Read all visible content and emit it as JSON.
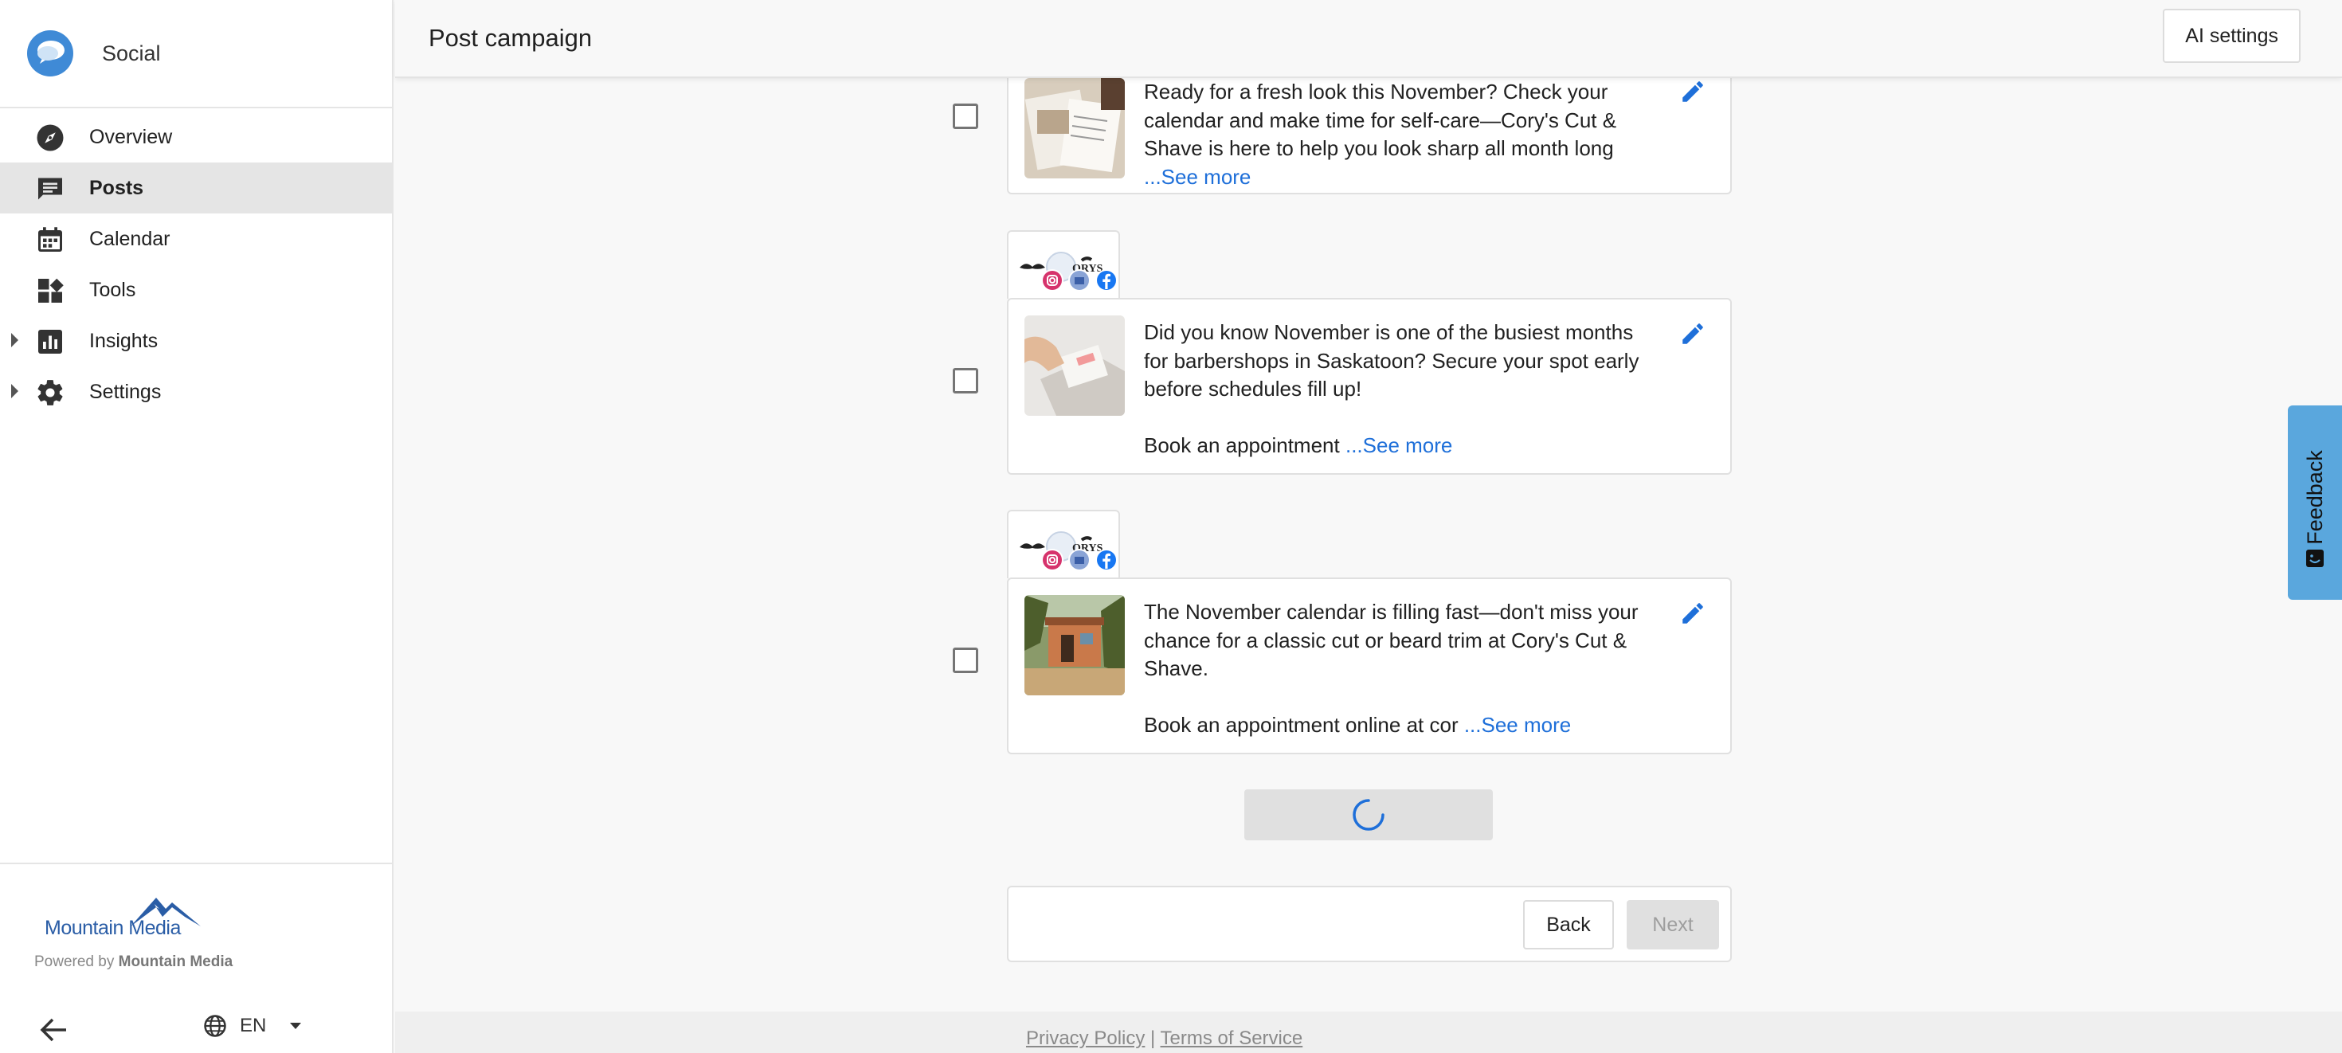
{
  "app": {
    "name": "Social"
  },
  "sidebar": {
    "items": [
      {
        "label": "Overview",
        "icon": "compass-icon"
      },
      {
        "label": "Posts",
        "icon": "chat-icon",
        "active": true
      },
      {
        "label": "Calendar",
        "icon": "calendar-icon"
      },
      {
        "label": "Tools",
        "icon": "tools-icon"
      },
      {
        "label": "Insights",
        "icon": "chart-icon",
        "expandable": true
      },
      {
        "label": "Settings",
        "icon": "gear-icon",
        "expandable": true
      }
    ],
    "brand_logo_text": "Mountain Media",
    "powered_prefix": "Powered by ",
    "powered_name": "Mountain Media",
    "language": "EN"
  },
  "header": {
    "title": "Post campaign",
    "ai_settings_label": "AI settings"
  },
  "posts": [
    {
      "lines": [
        "Ready for a fresh look this November? Check your",
        "calendar and make time for self-care—Cory's Cut &",
        "Shave is here to help you look sharp all month long"
      ],
      "extra": "",
      "see_more": "...See more",
      "image": "notebook-photo"
    },
    {
      "lines": [
        "Did you know November is one of the busiest months",
        "for barbershops in Saskatoon? Secure your spot early",
        "before schedules fill up!"
      ],
      "extra": "Book an appointment ",
      "see_more": "...See more",
      "image": "planner-photo",
      "channels": [
        "instagram-icon",
        "google-business-icon",
        "facebook-icon"
      ]
    },
    {
      "lines": [
        "The November calendar is filling fast—don't miss your",
        "chance for a classic cut or beard trim at Cory's Cut &",
        "Shave."
      ],
      "extra": "Book an appointment online at cor ",
      "see_more": "...See more",
      "image": "barbershop-photo",
      "channels": [
        "instagram-icon",
        "google-business-icon",
        "facebook-icon"
      ]
    }
  ],
  "channel_logo_text": "ORYS",
  "actions": {
    "back_label": "Back",
    "next_label": "Next"
  },
  "footer": {
    "privacy": "Privacy Policy",
    "separator": " | ",
    "terms": "Terms of Service"
  },
  "feedback": {
    "label": "Feedback"
  },
  "colors": {
    "accent": "#1e6fd9",
    "brand": "#3f8ad6",
    "feedback": "#5aa7dd"
  }
}
